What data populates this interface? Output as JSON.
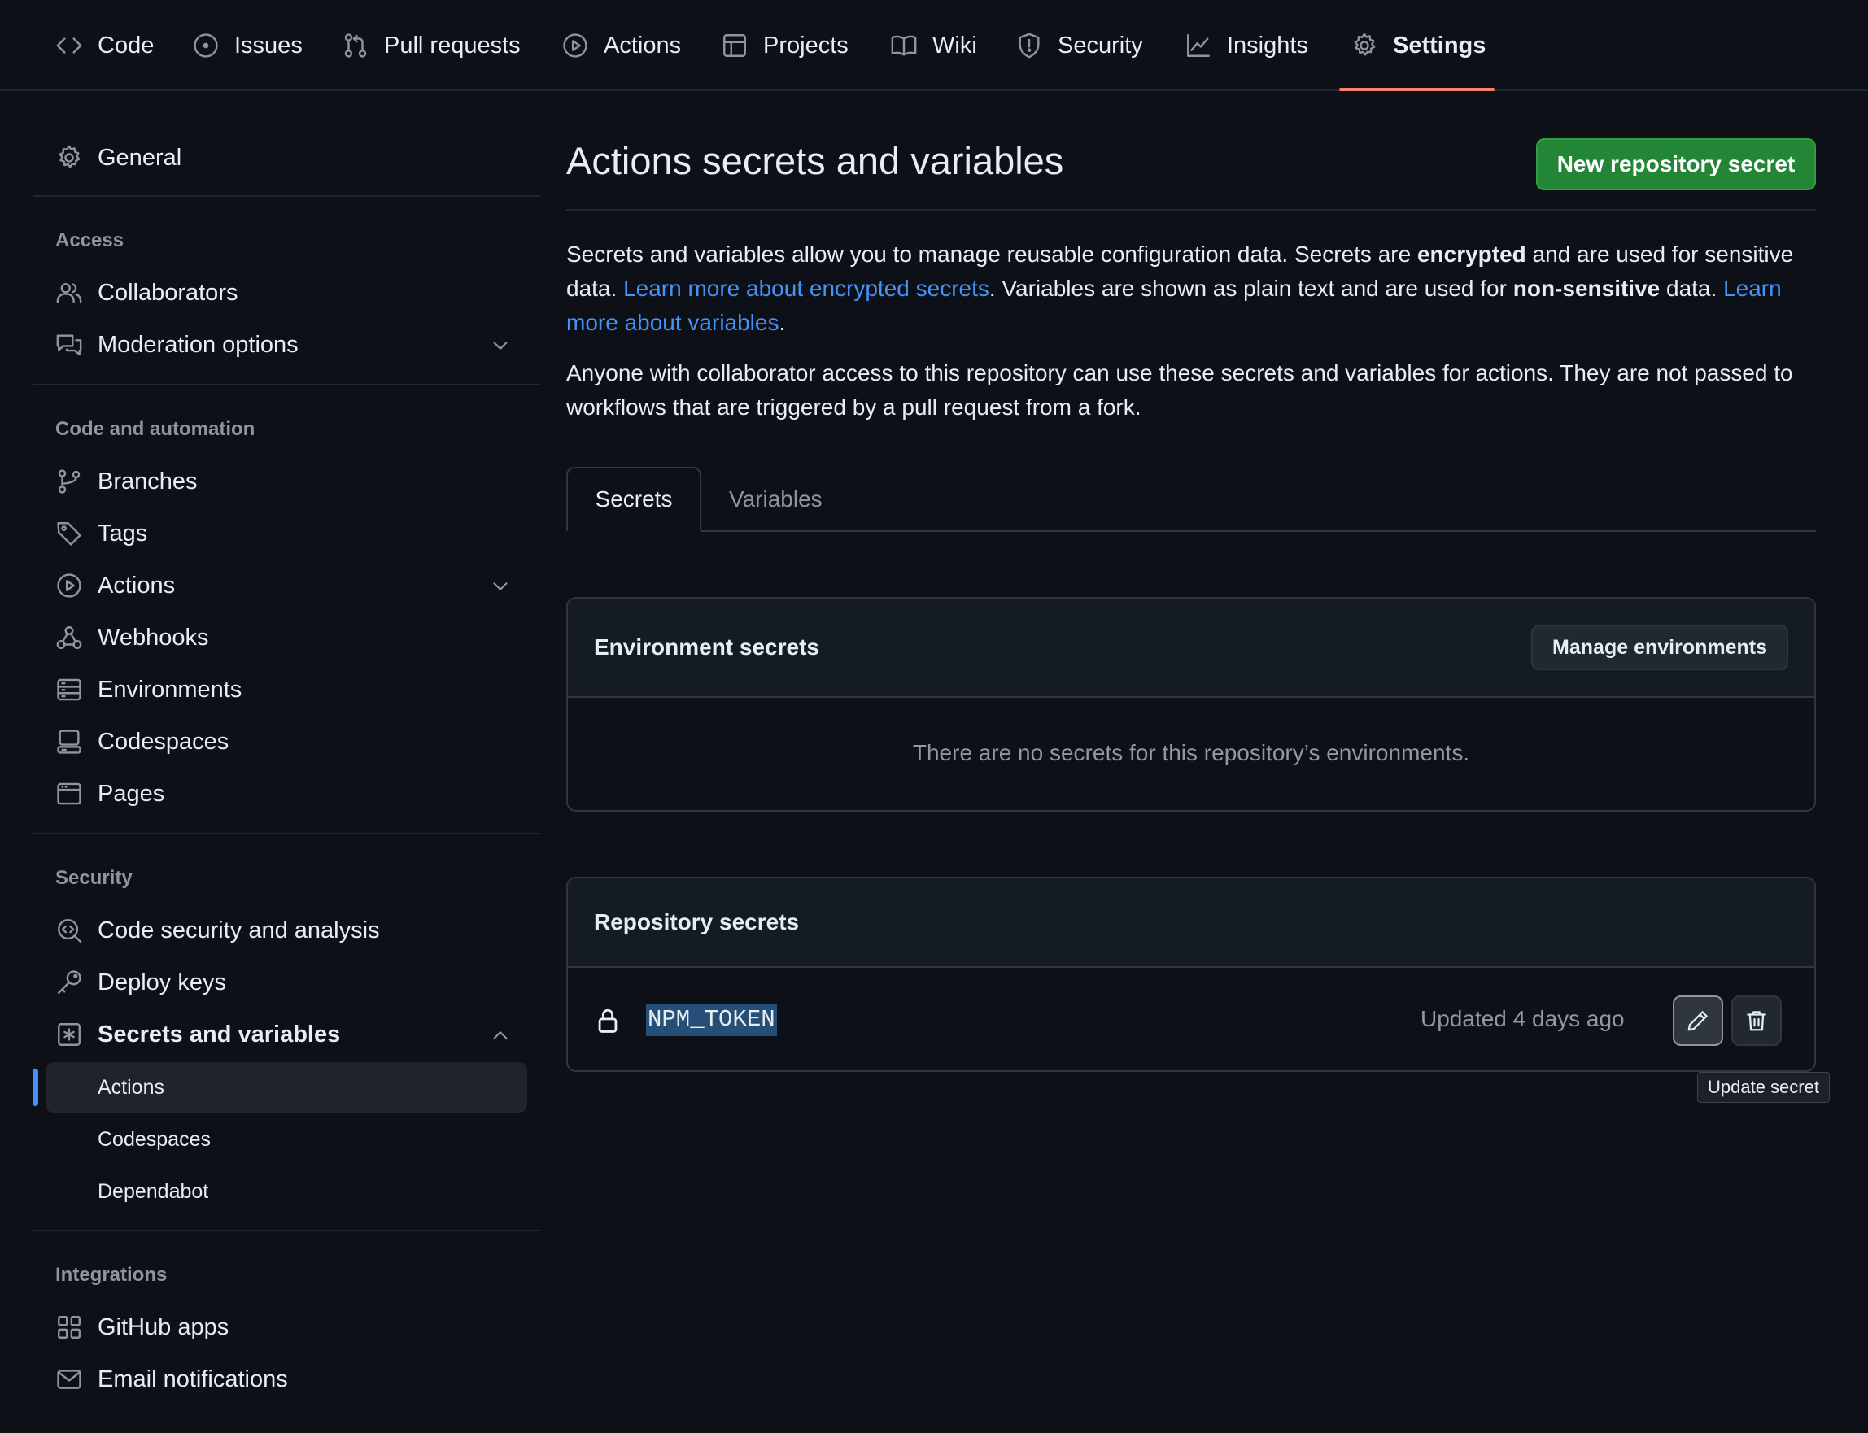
{
  "topnav": {
    "code": "Code",
    "issues": "Issues",
    "pull_requests": "Pull requests",
    "actions": "Actions",
    "projects": "Projects",
    "wiki": "Wiki",
    "security": "Security",
    "insights": "Insights",
    "settings": "Settings"
  },
  "sidebar": {
    "general": "General",
    "access_heading": "Access",
    "collaborators": "Collaborators",
    "moderation": "Moderation options",
    "code_heading": "Code and automation",
    "branches": "Branches",
    "tags": "Tags",
    "actions": "Actions",
    "webhooks": "Webhooks",
    "environments": "Environments",
    "codespaces": "Codespaces",
    "pages": "Pages",
    "security_heading": "Security",
    "code_security": "Code security and analysis",
    "deploy_keys": "Deploy keys",
    "secrets_vars": "Secrets and variables",
    "sub_actions": "Actions",
    "sub_codespaces": "Codespaces",
    "sub_dependabot": "Dependabot",
    "integrations_heading": "Integrations",
    "github_apps": "GitHub apps",
    "email_notifications": "Email notifications"
  },
  "main": {
    "title": "Actions secrets and variables",
    "new_secret_button": "New repository secret",
    "intro": {
      "p1a": "Secrets and variables allow you to manage reusable configuration data. Secrets are ",
      "p1b": "encrypted",
      "p1c": " and are used for sensitive data. ",
      "link1": "Learn more about encrypted secrets",
      "p1d": ". Variables are shown as plain text and are used for ",
      "p1e": "non-sensitive",
      "p1f": " data. ",
      "link2": "Learn more about variables",
      "p1g": "."
    },
    "paragraph2": "Anyone with collaborator access to this repository can use these secrets and variables for actions. They are not passed to workflows that are triggered by a pull request from a fork.",
    "tabs": {
      "secrets": "Secrets",
      "variables": "Variables"
    },
    "env_secrets": {
      "title": "Environment secrets",
      "manage_button": "Manage environments",
      "empty": "There are no secrets for this repository’s environments."
    },
    "repo_secrets": {
      "title": "Repository secrets",
      "items": [
        {
          "name": "NPM_TOKEN",
          "updated": "Updated 4 days ago"
        }
      ]
    },
    "tooltip": "Update secret"
  },
  "colors": {
    "background": "#0d1117",
    "accent_underline": "#f78166",
    "primary_button": "#238636",
    "link": "#4493f8"
  }
}
